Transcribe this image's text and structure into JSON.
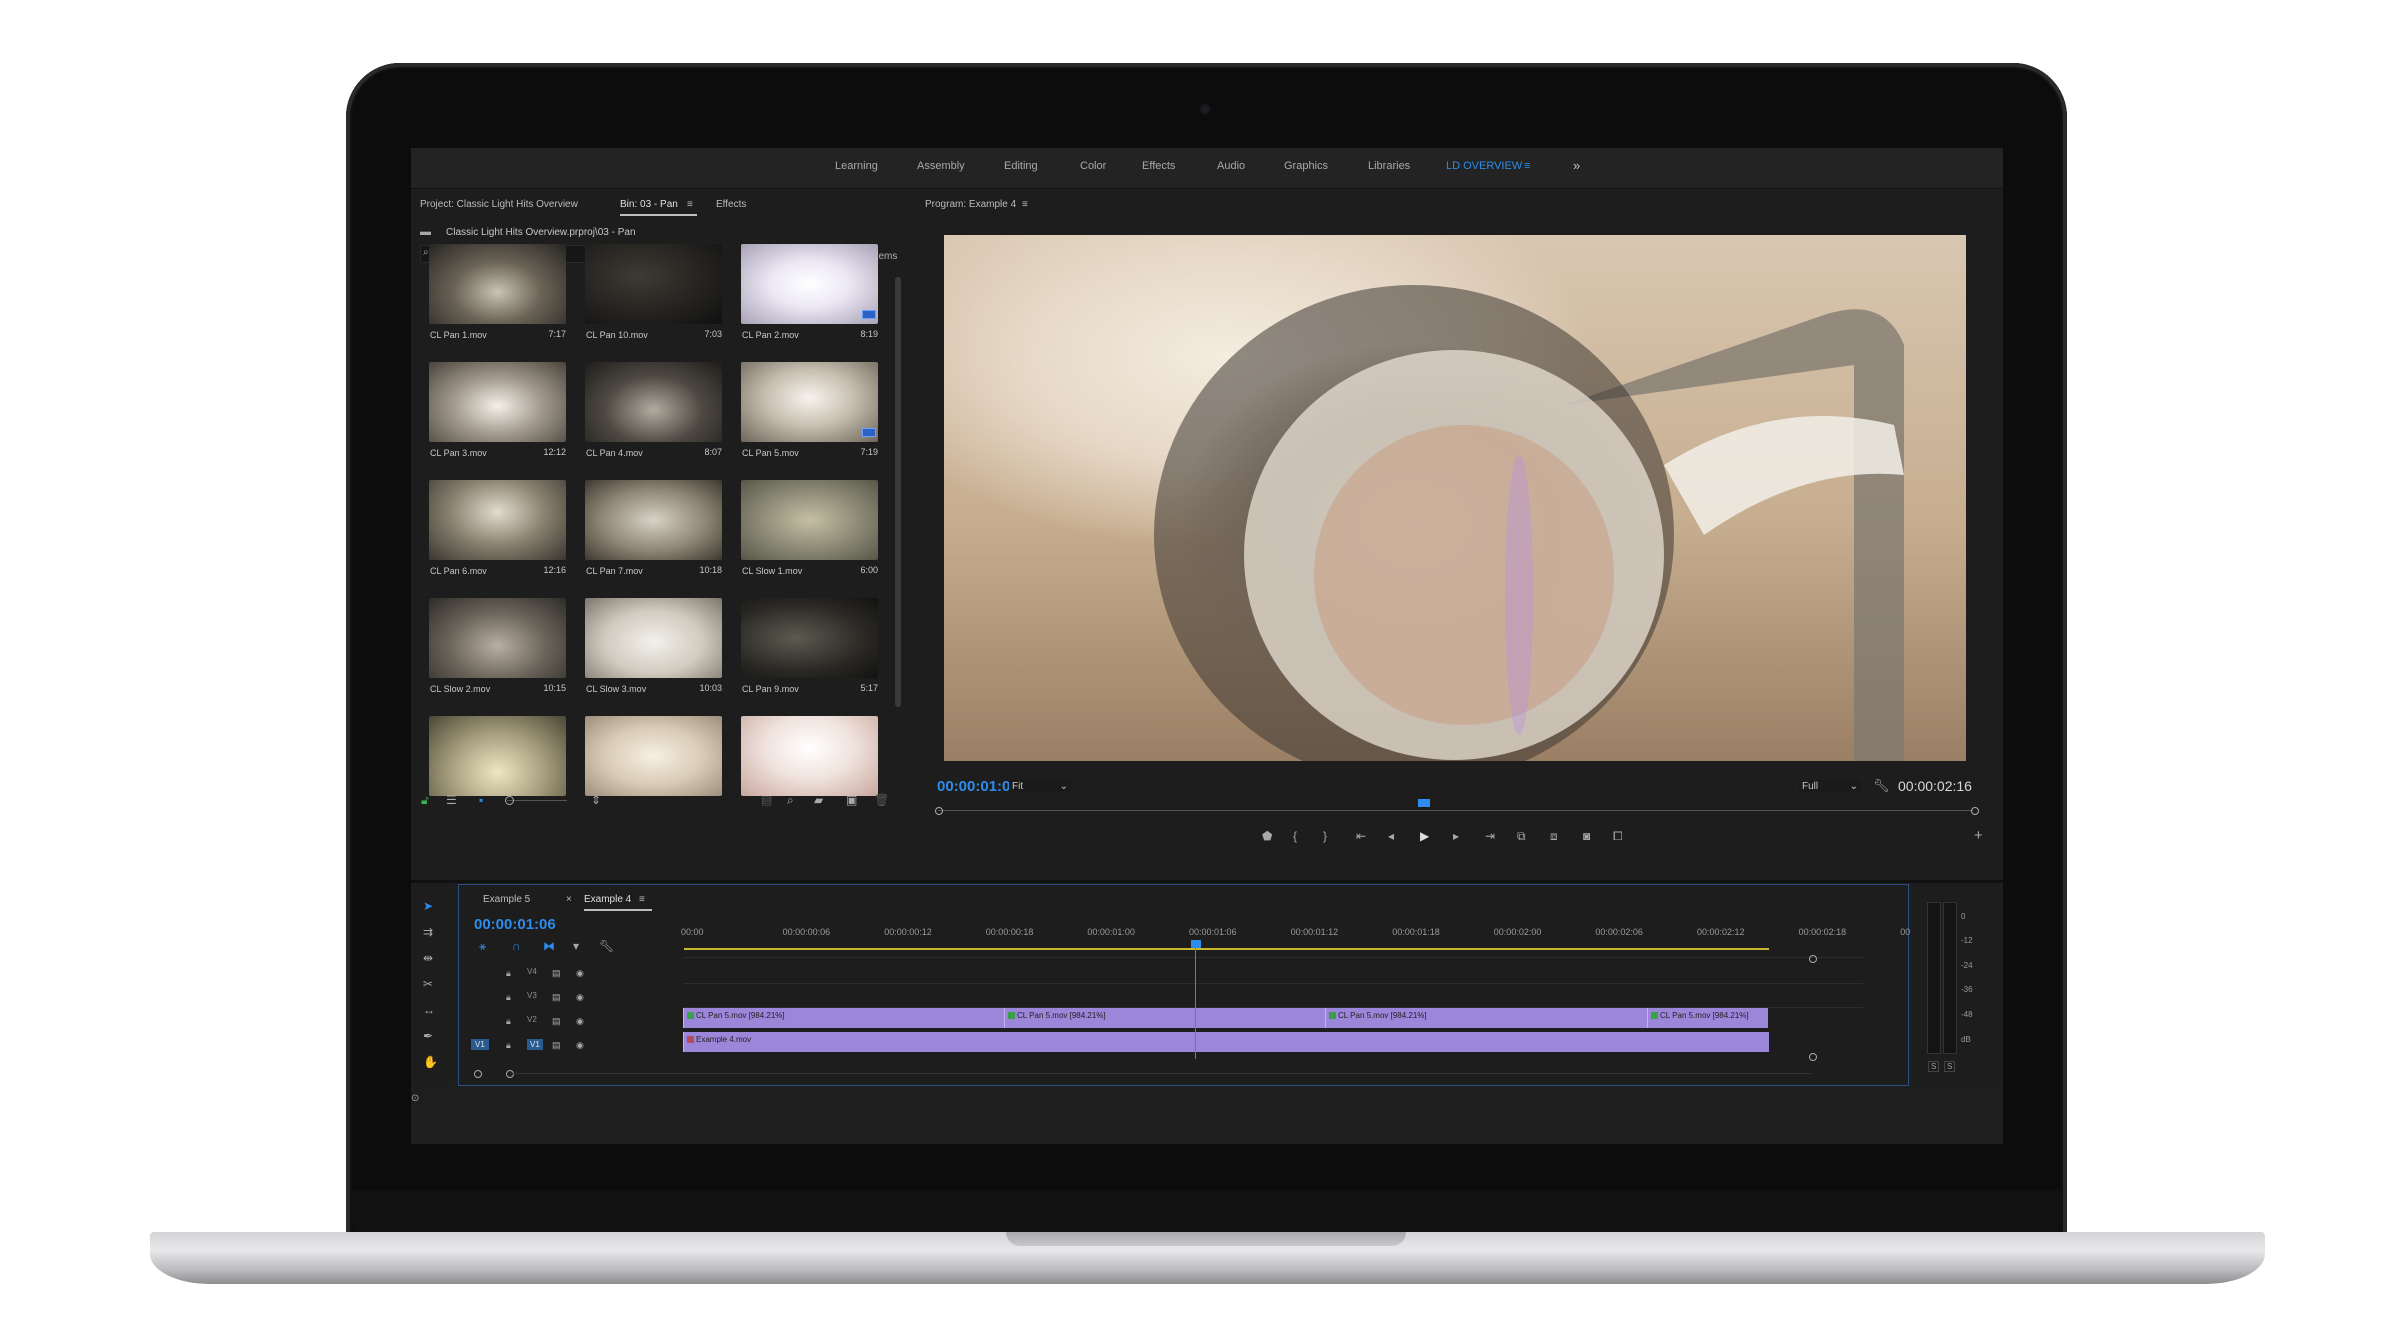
{
  "workspaces": {
    "tabs": [
      "Learning",
      "Assembly",
      "Editing",
      "Color",
      "Effects",
      "Audio",
      "Graphics",
      "Libraries",
      "LD OVERVIEW"
    ],
    "active_index": 8,
    "menu_icon": "hamburger-icon",
    "more_label": "»"
  },
  "project_panel": {
    "tabs": [
      "Project: Classic Light Hits Overview",
      "Bin: 03 - Pan",
      "Effects"
    ],
    "active_tab": 1,
    "path": "Classic Light Hits Overview.prproj\\03 - Pan",
    "search_placeholder": "",
    "items_count": "16 Items",
    "clips": [
      {
        "name": "CL Pan 1.mov",
        "duration": "7:17"
      },
      {
        "name": "CL Pan 10.mov",
        "duration": "7:03"
      },
      {
        "name": "CL Pan 2.mov",
        "duration": "8:19"
      },
      {
        "name": "CL Pan 3.mov",
        "duration": "12:12"
      },
      {
        "name": "CL Pan 4.mov",
        "duration": "8:07"
      },
      {
        "name": "CL Pan 5.mov",
        "duration": "7:19"
      },
      {
        "name": "CL Pan 6.mov",
        "duration": "12:16"
      },
      {
        "name": "CL Pan 7.mov",
        "duration": "10:18"
      },
      {
        "name": "CL Slow 1.mov",
        "duration": "6:00"
      },
      {
        "name": "CL Slow 2.mov",
        "duration": "10:15"
      },
      {
        "name": "CL Slow 3.mov",
        "duration": "10:03"
      },
      {
        "name": "CL Pan 9.mov",
        "duration": "5:17"
      },
      {
        "name": "",
        "duration": ""
      },
      {
        "name": "",
        "duration": ""
      },
      {
        "name": "",
        "duration": ""
      }
    ]
  },
  "program_monitor": {
    "title": "Program: Example 4",
    "current_timecode": "00:00:01:06",
    "zoom": "Fit",
    "resolution": "Full",
    "duration_timecode": "00:00:02:16",
    "playhead_fraction": 0.47
  },
  "timeline": {
    "tabs": [
      "Example 5",
      "Example 4"
    ],
    "active_tab": 1,
    "timecode": "00:00:01:06",
    "ruler": [
      "00:00",
      "00:00:00:06",
      "00:00:00:12",
      "00:00:00:18",
      "00:00:01:00",
      "00:00:01:06",
      "00:00:01:12",
      "00:00:01:18",
      "00:00:02:00",
      "00:00:02:06",
      "00:00:02:12",
      "00:00:02:18",
      "00"
    ],
    "tracks": [
      "V4",
      "V3",
      "V2",
      "V1"
    ],
    "source_patch": "V1",
    "v2_clips": [
      "CL Pan 5.mov [984.21%]",
      "CL Pan 5.mov [984.21%]",
      "CL Pan 5.mov [984.21%]",
      "CL Pan 5.mov [984.21%]"
    ],
    "v1_clip": "Example 4.mov"
  },
  "audio_meter": {
    "labels": [
      "0",
      "-12",
      "-24",
      "-36",
      "-48",
      "dB"
    ],
    "solo": [
      "S",
      "S"
    ]
  }
}
